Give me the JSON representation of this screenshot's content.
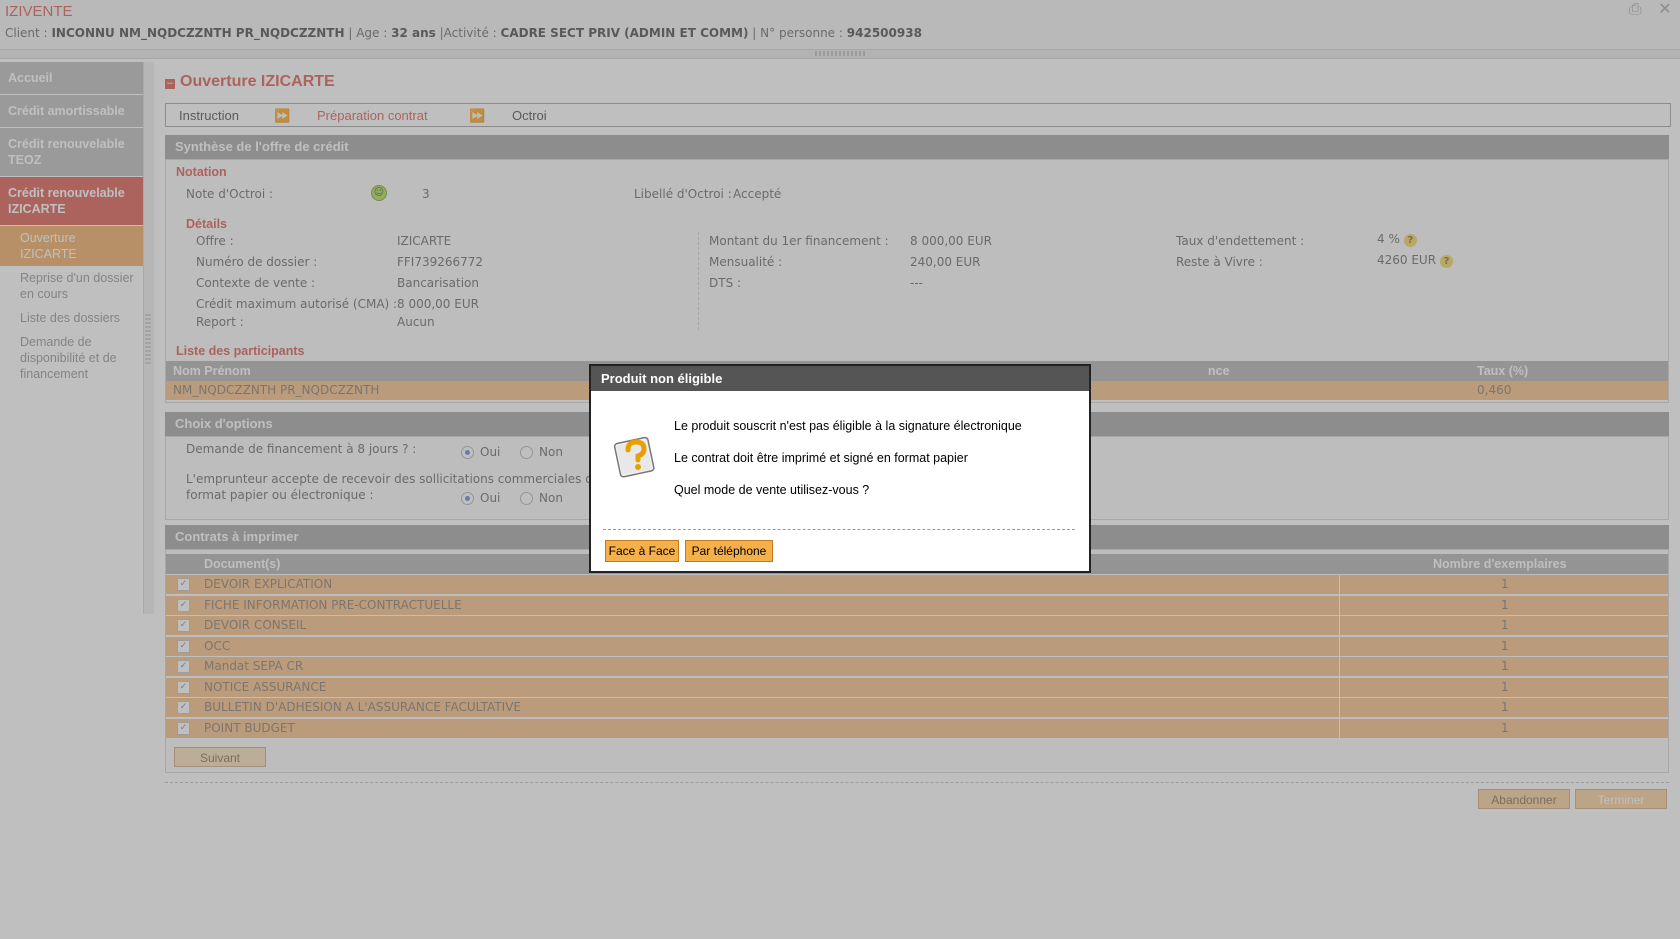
{
  "app": {
    "title": "IZIVENTE"
  },
  "client": {
    "label": "Client :",
    "name": "INCONNU NM_NQDCZZNTH PR_NQDCZZNTH",
    "age_label": "| Age :",
    "age": "32 ans",
    "activity_label": "|Activité :",
    "activity": "CADRE SECT PRIV (ADMIN ET COMM)",
    "person_label": "| N° personne :",
    "person": "942500938"
  },
  "sidebar": {
    "items": [
      {
        "label": "Accueil"
      },
      {
        "label": "Crédit amortissable"
      },
      {
        "label": "Crédit renouvelable TEOZ"
      },
      {
        "label": "Crédit renouvelable IZICARTE"
      }
    ],
    "sub_items": [
      {
        "label": "Ouverture IZICARTE"
      },
      {
        "label": "Reprise d'un dossier en cours"
      },
      {
        "label": "Liste des dossiers"
      },
      {
        "label": "Demande de disponibilité et de financement"
      }
    ]
  },
  "page": {
    "title": "Ouverture IZICARTE"
  },
  "steps": [
    "Instruction",
    "Préparation contrat",
    "Octroi"
  ],
  "synthese": {
    "header": "Synthèse de l'offre de crédit",
    "notation_label": "Notation",
    "note_label": "Note d'Octroi :",
    "note_value": "3",
    "libelle_label": "Libellé d'Octroi :",
    "libelle_value": "Accepté",
    "details_label": "Détails",
    "col1": [
      {
        "label": "Offre :",
        "value": "IZICARTE"
      },
      {
        "label": "Numéro de dossier :",
        "value": "FFI739266772"
      },
      {
        "label": "Contexte de vente :",
        "value": "Bancarisation"
      },
      {
        "label": "Crédit maximum autorisé (CMA) :",
        "value": "8 000,00 EUR"
      },
      {
        "label": "Report :",
        "value": "Aucun"
      }
    ],
    "col2": [
      {
        "label": "Montant du 1er financement :",
        "value": "8 000,00 EUR"
      },
      {
        "label": "Mensualité :",
        "value": "240,00 EUR"
      },
      {
        "label": "DTS :",
        "value": "---"
      }
    ],
    "col3": [
      {
        "label": "Taux d'endettement :",
        "value": "4 %"
      },
      {
        "label": "Reste à Vivre :",
        "value": "4260 EUR"
      }
    ],
    "participants_label": "Liste des participants",
    "participants_headers": [
      "Nom Prénom",
      "",
      "nce",
      "Taux (%)"
    ],
    "participants": [
      {
        "name": "NM_NQDCZZNTH PR_NQDCZZNTH",
        "rate": "0,460"
      }
    ]
  },
  "options": {
    "header": "Choix d'options",
    "q1": "Demande de financement à 8 jours ? :",
    "q2_line1": "L'emprunteur accepte de recevoir des sollicitations commerciales de l'é",
    "q2_line2": "format papier ou électronique :",
    "yes": "Oui",
    "no": "Non"
  },
  "contrats": {
    "header": "Contrats à imprimer",
    "col_doc": "Document(s)",
    "col_count": "Nombre d'exemplaires",
    "rows": [
      {
        "doc": "DEVOIR EXPLICATION",
        "count": "1"
      },
      {
        "doc": "FICHE INFORMATION PRE-CONTRACTUELLE",
        "count": "1"
      },
      {
        "doc": "DEVOIR CONSEIL",
        "count": "1"
      },
      {
        "doc": "OCC",
        "count": "1"
      },
      {
        "doc": "Mandat SEPA CR",
        "count": "1"
      },
      {
        "doc": "NOTICE ASSURANCE",
        "count": "1"
      },
      {
        "doc": "BULLETIN D'ADHESION A L'ASSURANCE FACULTATIVE",
        "count": "1"
      },
      {
        "doc": "POINT BUDGET",
        "count": "1"
      }
    ],
    "next": "Suivant"
  },
  "footer": {
    "abandon": "Abandonner",
    "finish": "Terminer"
  },
  "modal": {
    "title": "Produit non éligible",
    "line1": "Le produit souscrit n'est pas éligible à la signature électronique",
    "line2": "Le contrat doit être imprimé et signé en format papier",
    "line3": "Quel mode de vente utilisez-vous ?",
    "btn_face": "Face à Face",
    "btn_phone": "Par téléphone"
  }
}
